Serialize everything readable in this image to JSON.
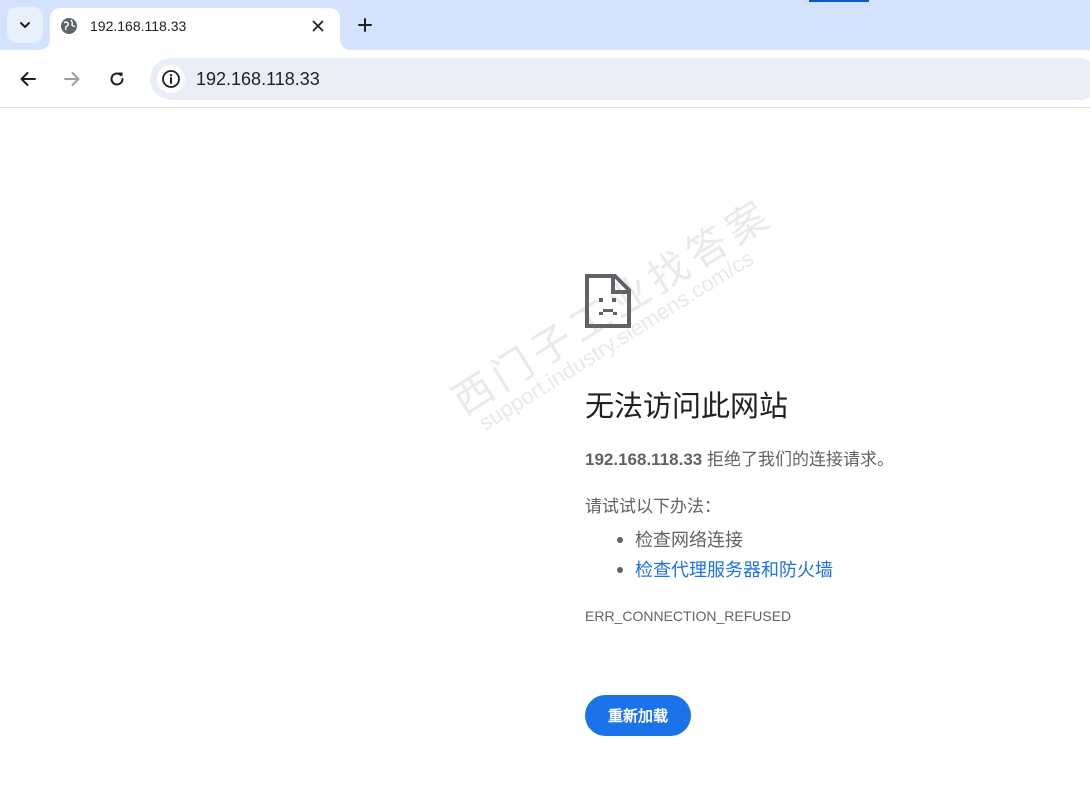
{
  "browser": {
    "tab": {
      "title": "192.168.118.33",
      "favicon": "globe-icon",
      "close_icon": "close-icon"
    },
    "tab_search_icon": "chevron-down-icon",
    "new_tab_icon": "plus-icon",
    "toolbar": {
      "back_icon": "arrow-left-icon",
      "forward_icon": "arrow-right-icon",
      "reload_icon": "reload-icon",
      "site_info_icon": "info-icon",
      "url": "192.168.118.33"
    }
  },
  "error_page": {
    "icon": "sad-page-icon",
    "title": "无法访问此网站",
    "host": "192.168.118.33",
    "description_suffix": " 拒绝了我们的连接请求。",
    "suggestions_title": "请试试以下办法：",
    "suggestions": [
      {
        "text": "检查网络连接",
        "is_link": false
      },
      {
        "text": "检查代理服务器和防火墙",
        "is_link": true
      }
    ],
    "error_code": "ERR_CONNECTION_REFUSED",
    "reload_label": "重新加载"
  },
  "watermark": {
    "line1": "西门子工业",
    "line2": "找答案",
    "line3": "support.industry.siemens.com/cs"
  },
  "colors": {
    "accent": "#1a73e8",
    "tabstrip": "#d3e3fd",
    "omnibox": "#e9eef6",
    "text_secondary": "#5f6368"
  }
}
